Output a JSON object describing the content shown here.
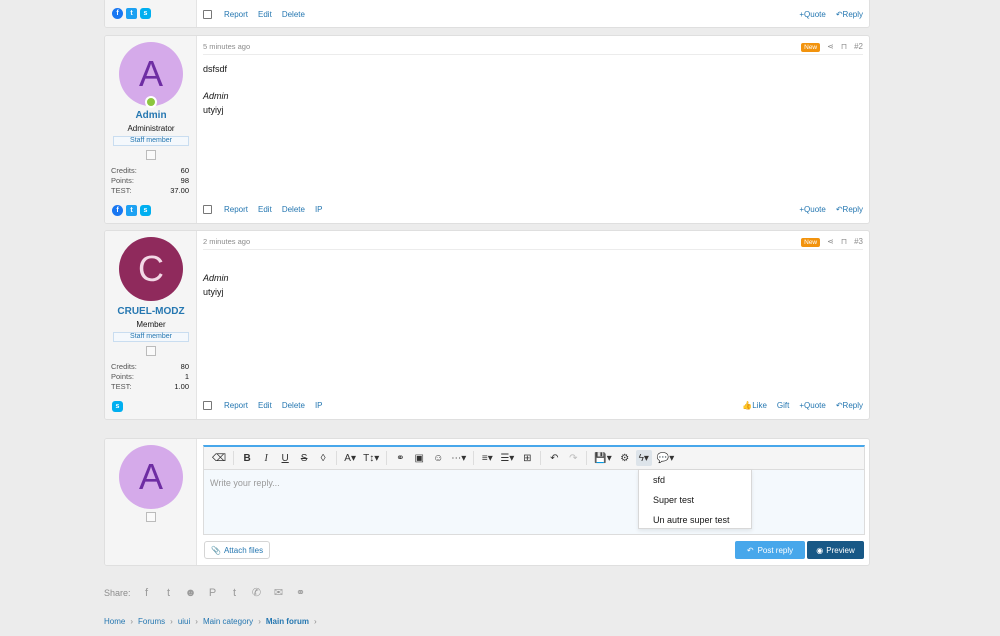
{
  "post1_partial": {
    "actions": [
      "Report",
      "Edit",
      "Delete"
    ],
    "right_actions": [
      "Quote",
      "Reply"
    ]
  },
  "post2": {
    "time": "5 minutes ago",
    "badge": "New",
    "number": "#2",
    "user": {
      "initial": "A",
      "name": "Admin",
      "title": "Administrator",
      "staff": "Staff member"
    },
    "stats": [
      {
        "label": "Credits:",
        "value": "60"
      },
      {
        "label": "Points:",
        "value": "98"
      },
      {
        "label": "TEST:",
        "value": "37.00"
      }
    ],
    "lines": [
      "dsfsdf"
    ],
    "quote_author": "Admin",
    "quote_text": "utyiyj",
    "actions": [
      "Report",
      "Edit",
      "Delete",
      "IP"
    ],
    "right_actions": [
      "Quote",
      "Reply"
    ]
  },
  "post3": {
    "time": "2 minutes ago",
    "badge": "New",
    "number": "#3",
    "user": {
      "initial": "C",
      "name": "CRUEL-MODZ",
      "title": "Member",
      "staff": "Staff member"
    },
    "stats": [
      {
        "label": "Credits:",
        "value": "80"
      },
      {
        "label": "Points:",
        "value": "1"
      },
      {
        "label": "TEST:",
        "value": "1.00"
      }
    ],
    "quote_author": "Admin",
    "quote_text": "utyiyj",
    "actions": [
      "Report",
      "Edit",
      "Delete",
      "IP"
    ],
    "right_actions": [
      "Like",
      "Gift",
      "Quote",
      "Reply"
    ]
  },
  "reply": {
    "avatar_initial": "A",
    "placeholder": "Write your reply...",
    "dropdown": [
      "sfd",
      "Super test",
      "Un autre super test"
    ],
    "attach": "Attach files",
    "post_reply": "Post reply",
    "preview": "Preview"
  },
  "share_label": "Share:",
  "breadcrumbs": [
    "Home",
    "Forums",
    "uiui",
    "Main category",
    "Main forum"
  ],
  "colors": {
    "accent": "#2577b1",
    "new_badge": "#f2930d",
    "primary_button": "#47a7eb",
    "preview_button": "#185886"
  }
}
